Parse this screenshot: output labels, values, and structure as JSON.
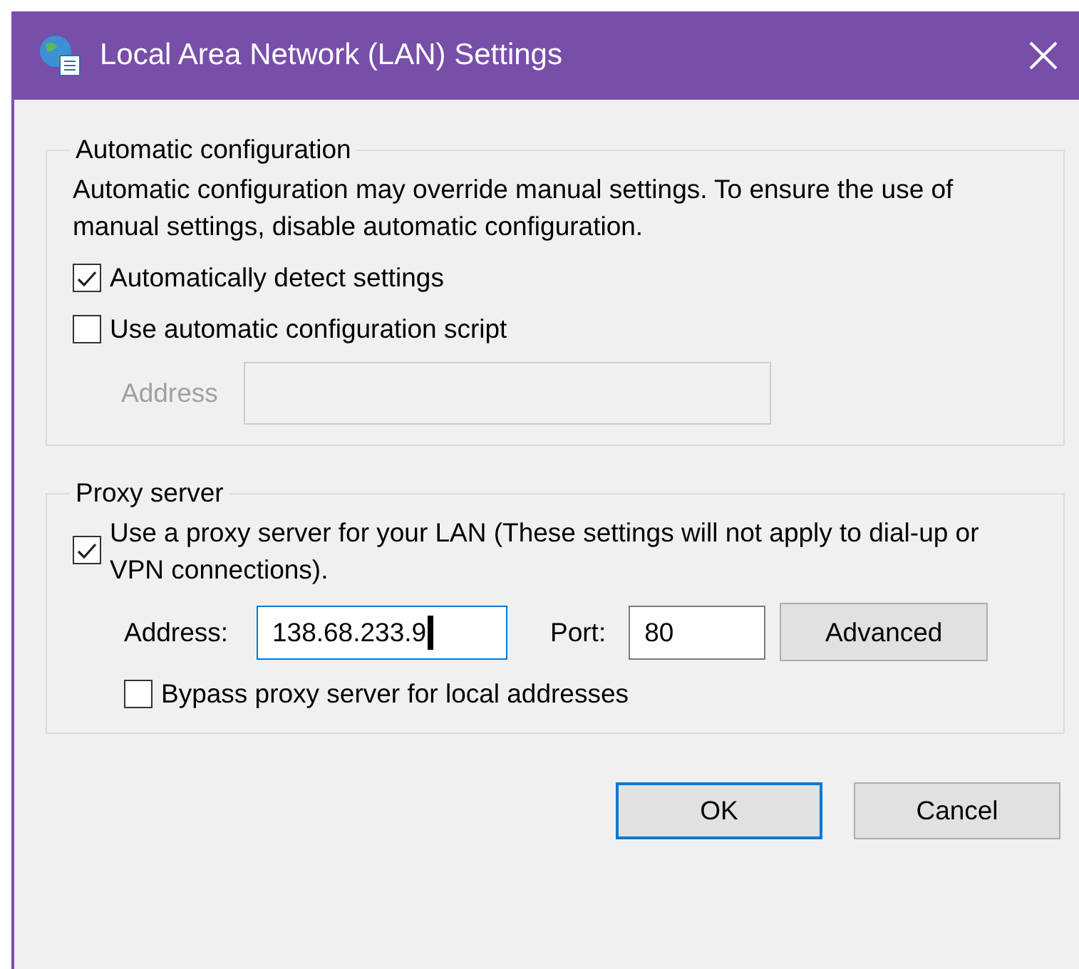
{
  "window": {
    "title": "Local Area Network (LAN) Settings"
  },
  "groups": [
    {
      "title": "Automatic configuration",
      "items": [
        {
          "kind": "text",
          "text": "Automatic configuration may override manual settings.  To ensure the use of manual settings, disable automatic configuration."
        },
        {
          "kind": "checkbox",
          "label": "Automatically detect settings",
          "checked": true
        },
        {
          "kind": "checkbox",
          "label": "Use automatic configuration script",
          "checked": false
        },
        {
          "kind": "field",
          "label": "Address",
          "disabled": true
        }
      ]
    },
    {
      "title": "Proxy server",
      "items": [
        {
          "kind": "checkbox",
          "label": "Use a proxy server for your LAN (These settings will not apply to dial-up or VPN connections).",
          "checked": true
        },
        {
          "kind": "proxy_row",
          "address": {
            "label": "Address:",
            "value": "138.68.233.9",
            "focused": true
          },
          "port": {
            "label": "Port:",
            "value": "80"
          },
          "button": "Advanced"
        },
        {
          "kind": "subcheckbox",
          "label": "Bypass proxy server for local addresses",
          "checked": false
        }
      ]
    }
  ],
  "buttons": [
    {
      "label": "OK",
      "default": true
    },
    {
      "label": "Cancel",
      "default": false
    }
  ]
}
